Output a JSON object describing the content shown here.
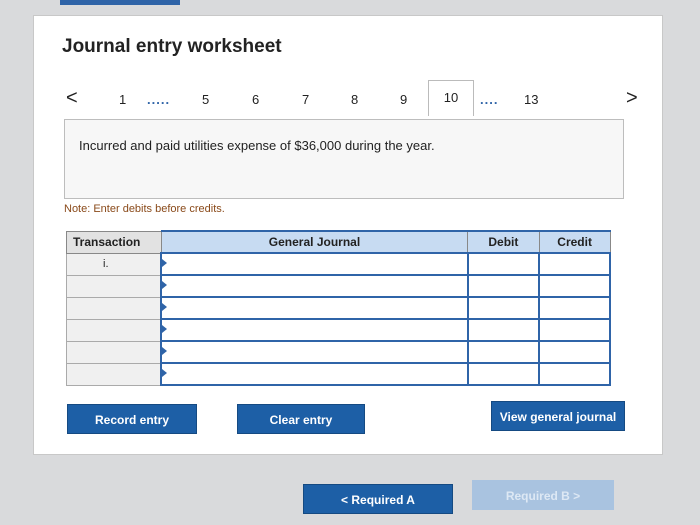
{
  "title": "Journal entry worksheet",
  "pager": {
    "prev": "<",
    "p1": "1",
    "dots1": ".....",
    "p5": "5",
    "p6": "6",
    "p7": "7",
    "p8": "8",
    "p9": "9",
    "p10": "10",
    "dots2": "....",
    "p13": "13",
    "next": ">"
  },
  "description": "Incurred and paid utilities expense of $36,000 during the year.",
  "note": "Note: Enter debits before credits.",
  "table": {
    "headers": [
      "Transaction",
      "General Journal",
      "Debit",
      "Credit"
    ],
    "first_transaction": "i."
  },
  "buttons": {
    "record": "Record entry",
    "clear": "Clear entry",
    "view": "View general journal",
    "required_a": "<  Required A",
    "required_b": "Required B  >"
  }
}
